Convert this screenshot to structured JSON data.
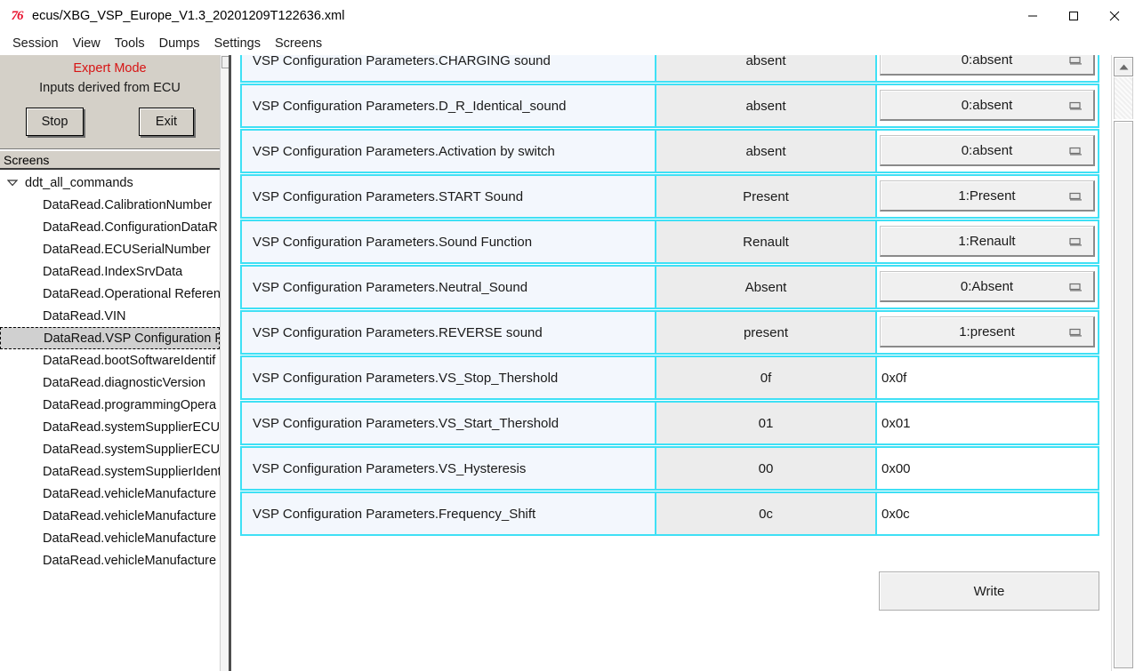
{
  "window": {
    "title": "ecus/XBG_VSP_Europe_V1.3_20201209T122636.xml",
    "app_icon": "tk-logo-icon",
    "minimize_label": "Minimize",
    "maximize_label": "Maximize",
    "close_label": "Close"
  },
  "menubar": {
    "items": [
      {
        "label": "Session"
      },
      {
        "label": "View"
      },
      {
        "label": "Tools"
      },
      {
        "label": "Dumps"
      },
      {
        "label": "Settings"
      },
      {
        "label": "Screens"
      }
    ]
  },
  "sidebar": {
    "expert_mode": "Expert Mode",
    "inputs_label": "Inputs derived from ECU",
    "stop_button": "Stop",
    "exit_button": "Exit",
    "screens_header": "Screens",
    "tree_root": "ddt_all_commands",
    "tree_items": [
      {
        "label": "DataRead.CalibrationNumber",
        "selected": false
      },
      {
        "label": "DataRead.ConfigurationDataR",
        "selected": false
      },
      {
        "label": "DataRead.ECUSerialNumber",
        "selected": false
      },
      {
        "label": "DataRead.IndexSrvData",
        "selected": false
      },
      {
        "label": "DataRead.Operational Referen",
        "selected": false
      },
      {
        "label": "DataRead.VIN",
        "selected": false
      },
      {
        "label": "DataRead.VSP Configuration P",
        "selected": true
      },
      {
        "label": "DataRead.bootSoftwareIdentif",
        "selected": false
      },
      {
        "label": "DataRead.diagnosticVersion",
        "selected": false
      },
      {
        "label": "DataRead.programmingOpera",
        "selected": false
      },
      {
        "label": "DataRead.systemSupplierECUS",
        "selected": false
      },
      {
        "label": "DataRead.systemSupplierECUS",
        "selected": false
      },
      {
        "label": "DataRead.systemSupplierIdent",
        "selected": false
      },
      {
        "label": "DataRead.vehicleManufacture",
        "selected": false
      },
      {
        "label": "DataRead.vehicleManufacture",
        "selected": false
      },
      {
        "label": "DataRead.vehicleManufacture",
        "selected": false
      },
      {
        "label": "DataRead.vehicleManufacture",
        "selected": false
      }
    ]
  },
  "main": {
    "rows": [
      {
        "label": "VSP Configuration Parameters.CHARGING sound",
        "value": "absent",
        "control": "combo",
        "control_value": "0:absent"
      },
      {
        "label": "VSP Configuration Parameters.D_R_Identical_sound",
        "value": "absent",
        "control": "combo",
        "control_value": "0:absent"
      },
      {
        "label": "VSP Configuration Parameters.Activation by switch",
        "value": "absent",
        "control": "combo",
        "control_value": "0:absent"
      },
      {
        "label": "VSP Configuration Parameters.START Sound",
        "value": "Present",
        "control": "combo",
        "control_value": "1:Present"
      },
      {
        "label": "VSP Configuration Parameters.Sound Function",
        "value": "Renault",
        "control": "combo",
        "control_value": "1:Renault"
      },
      {
        "label": "VSP Configuration Parameters.Neutral_Sound",
        "value": "Absent",
        "control": "combo",
        "control_value": "0:Absent"
      },
      {
        "label": "VSP Configuration Parameters.REVERSE sound",
        "value": "present",
        "control": "combo",
        "control_value": "1:present"
      },
      {
        "label": "VSP Configuration Parameters.VS_Stop_Thershold",
        "value": "0f",
        "control": "text",
        "control_value": "0x0f"
      },
      {
        "label": "VSP Configuration Parameters.VS_Start_Thershold",
        "value": "01",
        "control": "text",
        "control_value": "0x01"
      },
      {
        "label": "VSP Configuration Parameters.VS_Hysteresis",
        "value": "00",
        "control": "text",
        "control_value": "0x00"
      },
      {
        "label": "VSP Configuration Parameters.Frequency_Shift",
        "value": "0c",
        "control": "text",
        "control_value": "0x0c"
      }
    ],
    "write_button": "Write"
  },
  "colors": {
    "row_border_cyan": "#3fe0f5",
    "label_bg": "#f3f7fd",
    "value_bg": "#ececec",
    "expert_mode_red": "#d71414",
    "panel_gray": "#d4d0c8",
    "selection_gray": "#d0d0d0"
  }
}
